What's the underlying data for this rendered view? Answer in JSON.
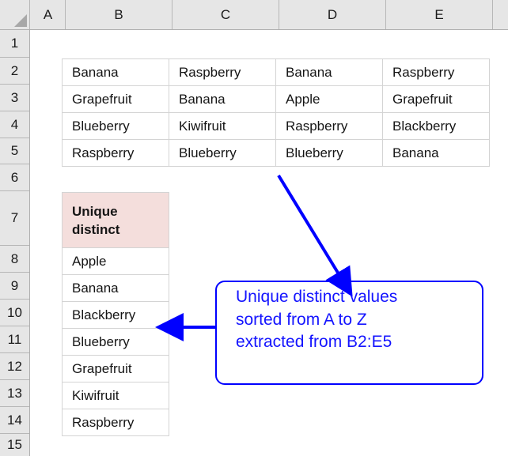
{
  "app": {
    "type": "spreadsheet",
    "corner_icon": "select-all-triangle-icon"
  },
  "grid": {
    "column_headers": [
      "A",
      "B",
      "C",
      "D",
      "E"
    ],
    "row_headers": [
      "1",
      "2",
      "3",
      "4",
      "5",
      "6",
      "7",
      "8",
      "9",
      "10",
      "11",
      "12",
      "13",
      "14",
      "15"
    ]
  },
  "source_table": {
    "range": "B2:E5",
    "rows": [
      [
        "Banana",
        "Raspberry",
        "Banana",
        "Raspberry"
      ],
      [
        "Grapefruit",
        "Banana",
        "Apple",
        "Grapefruit"
      ],
      [
        "Blueberry",
        "Kiwifruit",
        "Raspberry",
        "Blackberry"
      ],
      [
        "Raspberry",
        "Blueberry",
        "Blueberry",
        "Banana"
      ]
    ]
  },
  "unique_list": {
    "header": "Unique distinct",
    "header_bg": "#f4dedc",
    "values": [
      "Apple",
      "Banana",
      "Blackberry",
      "Blueberry",
      "Grapefruit",
      "Kiwifruit",
      "Raspberry"
    ]
  },
  "callout": {
    "text": "Unique distinct values sorted from A to Z extracted from B2:E5",
    "lines": [
      "Unique distinct values",
      "sorted from A to Z",
      "extracted from B2:E5"
    ],
    "color": "#0000ff"
  },
  "arrows": {
    "diagonal": "arrow-from-source-table-to-callout",
    "horizontal": "arrow-from-callout-to-unique-list"
  }
}
